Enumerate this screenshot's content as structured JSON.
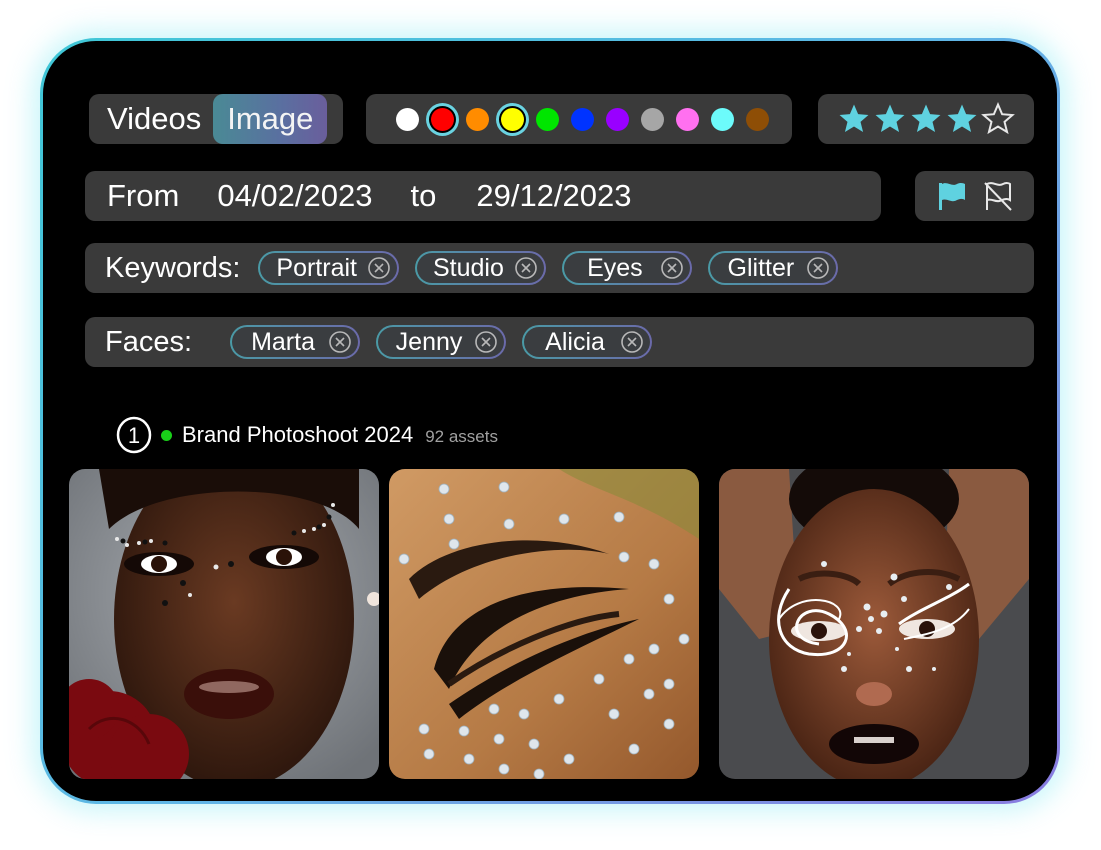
{
  "media_toggle": {
    "options": [
      {
        "label": "Videos",
        "active": false
      },
      {
        "label": "Image",
        "active": true
      }
    ]
  },
  "color_filter": {
    "swatches": [
      {
        "name": "white",
        "color": "#ffffff",
        "selected": false
      },
      {
        "name": "red",
        "color": "#ff0000",
        "selected": true
      },
      {
        "name": "orange",
        "color": "#ff8c00",
        "selected": false
      },
      {
        "name": "yellow",
        "color": "#ffff00",
        "selected": true
      },
      {
        "name": "green",
        "color": "#00e600",
        "selected": false
      },
      {
        "name": "blue",
        "color": "#0033ff",
        "selected": false
      },
      {
        "name": "purple",
        "color": "#9900ff",
        "selected": false
      },
      {
        "name": "gray",
        "color": "#a6a6a6",
        "selected": false
      },
      {
        "name": "pink",
        "color": "#ff70f0",
        "selected": false
      },
      {
        "name": "cyan",
        "color": "#6cfbfb",
        "selected": false
      },
      {
        "name": "brown",
        "color": "#8e4e06",
        "selected": false
      }
    ],
    "selected_ring_color": "#6ad3e1"
  },
  "rating": {
    "value": 4,
    "max": 5,
    "accent": "#5fd2e0"
  },
  "date_range": {
    "from_label": "From",
    "from_value": "04/02/2023",
    "to_label": "to",
    "to_value": "29/12/2023"
  },
  "flags": {
    "flagged_icon": "flag-filled-icon",
    "unflagged_icon": "flag-off-icon",
    "accent": "#5fd2e0"
  },
  "keywords": {
    "label": "Keywords:",
    "chips": [
      "Portrait",
      "Studio",
      "Eyes",
      "Glitter"
    ]
  },
  "faces": {
    "label": "Faces:",
    "chips": [
      "Marta",
      "Jenny",
      "Alicia"
    ]
  },
  "group": {
    "index": "1",
    "status_color": "#19d019",
    "title": "Brand Photoshoot 2024",
    "count": "92 assets"
  },
  "thumbnails": [
    {
      "alt": "Portrait with rhinestone eye makeup and red rose"
    },
    {
      "alt": "Close-up of closed eye with graphic liner and crystals"
    },
    {
      "alt": "Portrait with white graphic liner, crystals and dark lips"
    }
  ]
}
